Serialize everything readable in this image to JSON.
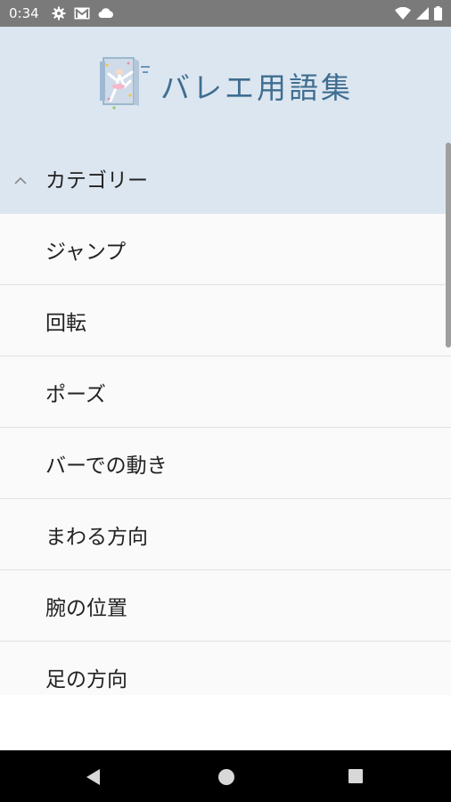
{
  "status_bar": {
    "time": "0:34",
    "left_icons": [
      "gear-icon",
      "gmail-icon",
      "cloud-icon"
    ],
    "right_icons": [
      "wifi-icon",
      "cell-signal-icon",
      "battery-icon"
    ],
    "background": "#7a7a7a"
  },
  "header": {
    "logo_icon": "ballet-logo-icon",
    "title": "バレエ用語集",
    "title_color": "#3f6e91",
    "background": "#dce6f0"
  },
  "category": {
    "label": "カテゴリー",
    "expanded": true,
    "icon": "chevron-up-icon"
  },
  "items": [
    {
      "label": "ジャンプ"
    },
    {
      "label": "回転"
    },
    {
      "label": "ポーズ"
    },
    {
      "label": "バーでの動き"
    },
    {
      "label": "まわる方向"
    },
    {
      "label": "腕の位置"
    },
    {
      "label": "足の方向"
    }
  ],
  "nav_bar": {
    "buttons": [
      "back-icon",
      "home-icon",
      "recents-icon"
    ]
  }
}
